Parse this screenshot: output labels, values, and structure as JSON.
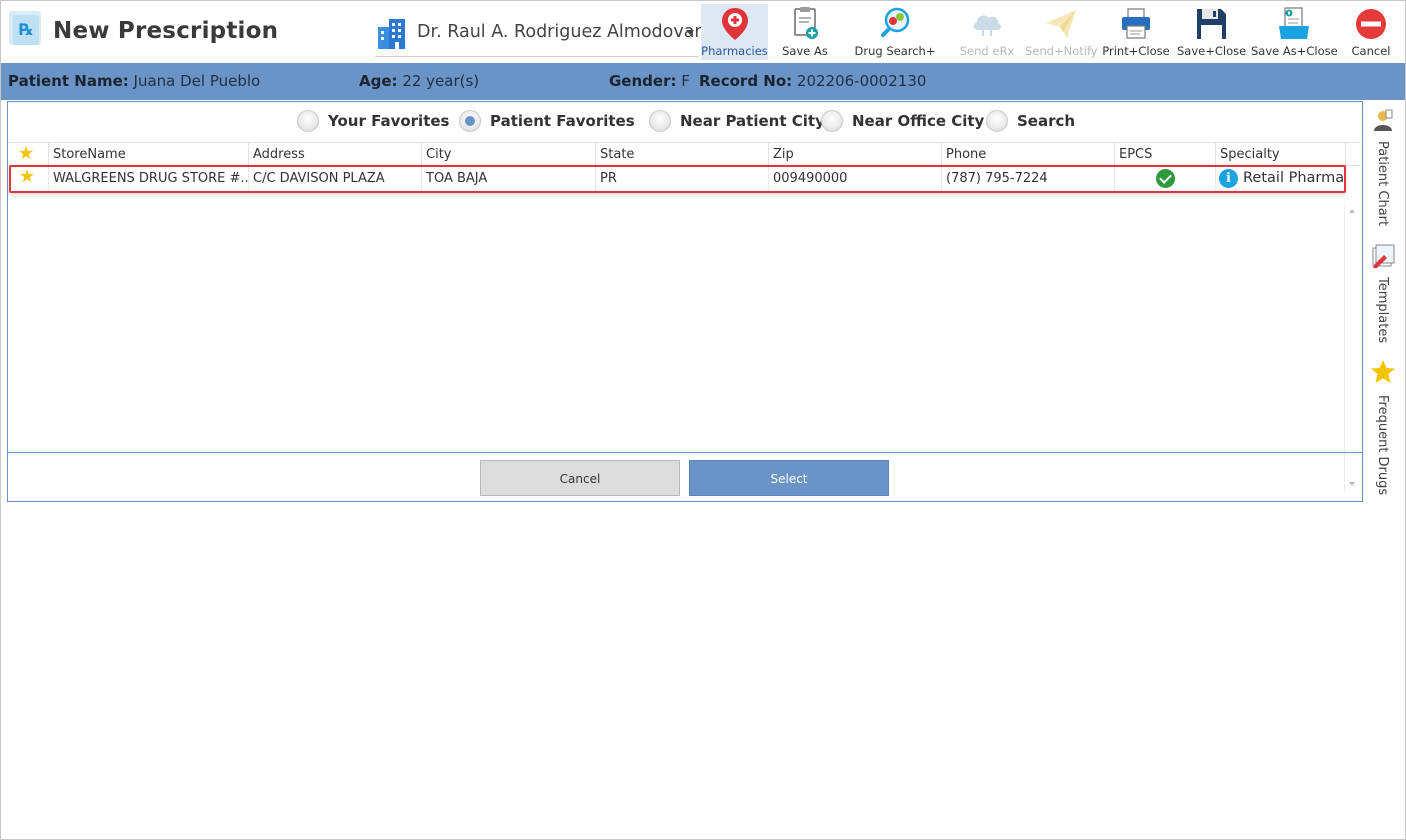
{
  "window": {
    "title": "New Prescription"
  },
  "provider": {
    "name": "Dr. Raul A. Rodriguez Almodovar"
  },
  "toolbar": [
    {
      "label": "Pharmacies",
      "icon": "map-pin-icon",
      "state": "active"
    },
    {
      "label": "Save As",
      "icon": "document-add-icon",
      "state": "normal"
    },
    {
      "label": "Drug Search+",
      "icon": "magnify-pill-icon",
      "state": "normal"
    },
    {
      "label": "Send eRx",
      "icon": "cloud-icon",
      "state": "disabled"
    },
    {
      "label": "Send+Notify",
      "icon": "paper-plane-icon",
      "state": "disabled"
    },
    {
      "label": "Print+Close",
      "icon": "printer-icon",
      "state": "normal"
    },
    {
      "label": "Save+Close",
      "icon": "floppy-icon",
      "state": "normal"
    },
    {
      "label": "Save As+Close",
      "icon": "save-as-icon",
      "state": "normal"
    },
    {
      "label": "Cancel",
      "icon": "cancel-icon",
      "state": "normal"
    }
  ],
  "patient": {
    "name_label": "Patient Name:",
    "name": "Juana Del Pueblo",
    "age_label": "Age:",
    "age": "22 year(s)",
    "gender_label": "Gender:",
    "gender": "F",
    "record_label": "Record No:",
    "record": "202206-0002130"
  },
  "side_panel": [
    {
      "label": "Patient Chart",
      "icon": "patient-chart-icon"
    },
    {
      "label": "Templates",
      "icon": "templates-icon"
    },
    {
      "label": "Frequent Drugs",
      "icon": "star-icon"
    }
  ],
  "filter_options": [
    {
      "label": "Your Favorites",
      "checked": false
    },
    {
      "label": "Patient Favorites",
      "checked": true
    },
    {
      "label": "Near Patient City",
      "checked": false
    },
    {
      "label": "Near Office City",
      "checked": false
    },
    {
      "label": "Search",
      "checked": false
    }
  ],
  "table": {
    "columns": [
      "StoreName",
      "Address",
      "City",
      "State",
      "Zip",
      "Phone",
      "EPCS",
      "Specialty"
    ],
    "rows": [
      {
        "favorite": true,
        "store_name": "WALGREENS DRUG STORE #...",
        "address": "C/C DAVISON PLAZA",
        "city": "TOA BAJA",
        "state": "PR",
        "zip": "009490000",
        "phone": "(787) 795-7224",
        "epcs": true,
        "specialty": "Retail Pharmacy"
      }
    ]
  },
  "dialog_buttons": {
    "cancel": "Cancel",
    "select": "Select"
  },
  "colors": {
    "accent": "#6b94c6",
    "highlight": "#e0343b",
    "star": "#f5c400",
    "epcs": "#2e9a3c"
  }
}
